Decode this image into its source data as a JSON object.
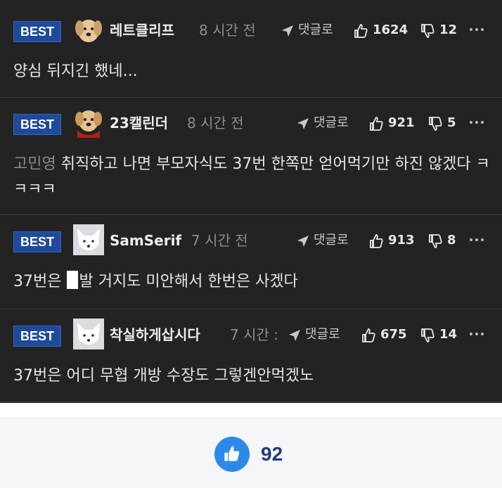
{
  "reply_label": "댓글로",
  "best_label": "BEST",
  "comments": [
    {
      "nick": "레트클리프",
      "time": "8 시간 전",
      "upvotes": "1624",
      "downvotes": "12",
      "avatar": "puppy-icon",
      "mention": "",
      "text": "양심 뒤지긴 했네..."
    },
    {
      "nick": "23캘린더",
      "time": "8 시간 전",
      "upvotes": "921",
      "downvotes": "5",
      "avatar": "puppy-red-icon",
      "mention": "고민영",
      "text": " 취직하고 나면 부모자식도 37번 한쪽만 얻어먹기만 하진 않겠다 ㅋㅋㅋㅋ"
    },
    {
      "nick": "SamSerif",
      "time": "7 시간 전",
      "upvotes": "913",
      "downvotes": "8",
      "avatar": "white-fox-icon",
      "text_before": "37번은 ",
      "text_after": "발 거지도 미안해서 한번은 사겠다"
    },
    {
      "nick": "착실하게삽시다",
      "time": "7 시간 :",
      "upvotes": "675",
      "downvotes": "14",
      "avatar": "white-fox-icon",
      "mention": "",
      "text": "37번은 어디 무협 개방 수장도 그렇겐안먹겠노"
    }
  ],
  "post_likes": "92",
  "colors": {
    "background_dark": "#232323",
    "badge_blue": "#1e4a9c",
    "like_blue": "#2b8ae8",
    "like_count": "#1f3c7a"
  }
}
